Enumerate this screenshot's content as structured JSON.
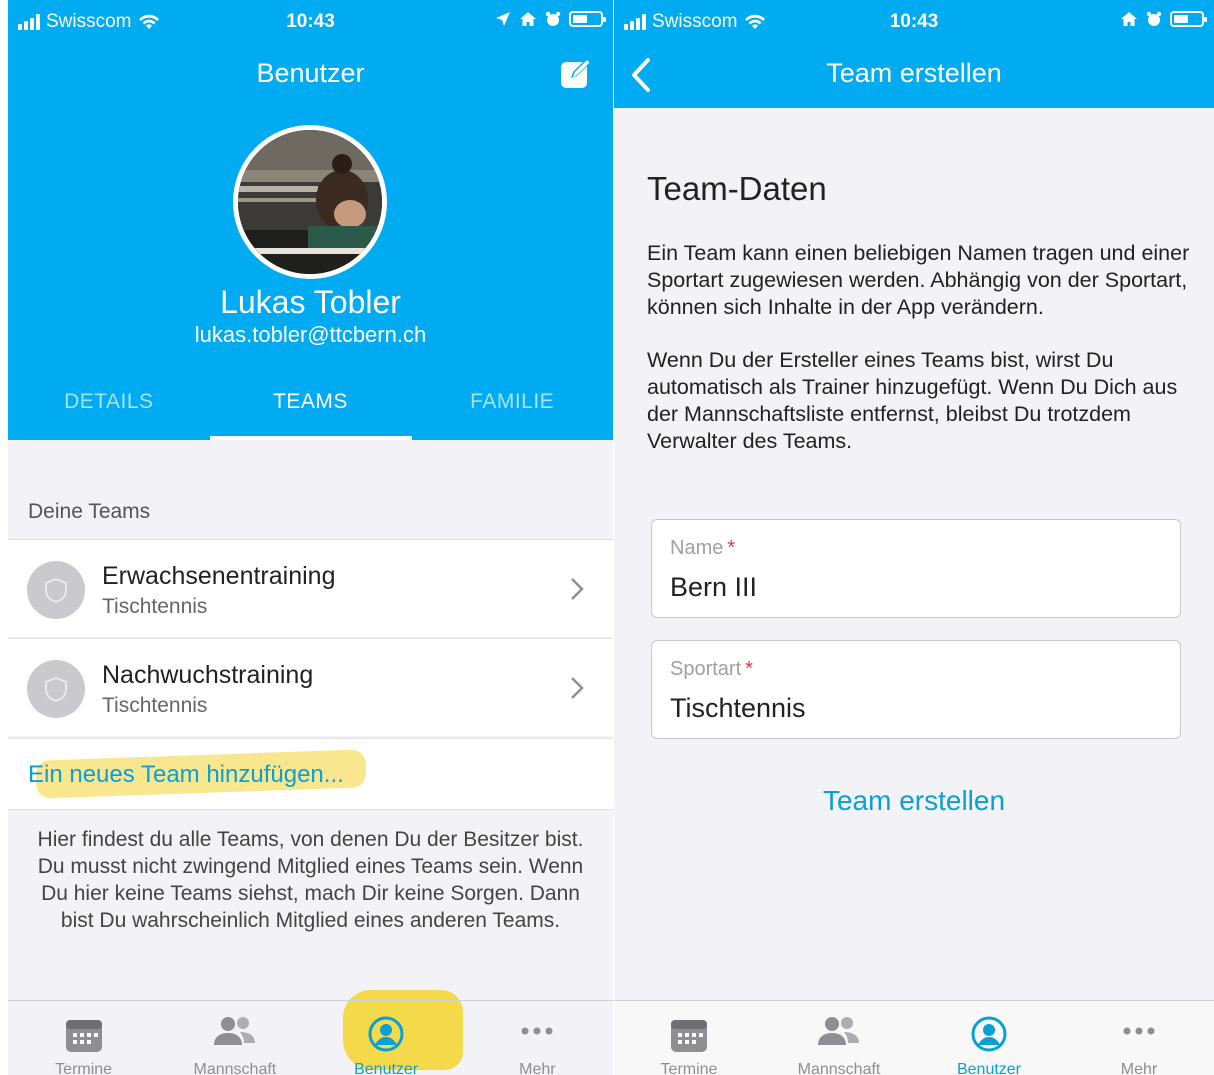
{
  "status_bar": {
    "carrier": "Swisscom",
    "time": "10:43"
  },
  "left_screen": {
    "nav_title": "Benutzer",
    "profile": {
      "name": "Lukas Tobler",
      "email": "lukas.tobler@ttcbern.ch"
    },
    "tabs": [
      {
        "label": "DETAILS",
        "active": false
      },
      {
        "label": "TEAMS",
        "active": true
      },
      {
        "label": "FAMILIE",
        "active": false
      }
    ],
    "section_header": "Deine Teams",
    "teams": [
      {
        "name": "Erwachsenentraining",
        "sport": "Tischtennis"
      },
      {
        "name": "Nachwuchstraining",
        "sport": "Tischtennis"
      }
    ],
    "add_team_label": "Ein neues Team hinzufügen...",
    "info_text": "Hier findest du alle Teams, von denen Du der Besitzer bist. Du musst nicht zwingend Mitglied eines Teams sein. Wenn Du hier keine Teams siehst, mach Dir keine Sorgen. Dann bist Du wahrscheinlich Mitglied eines anderen Teams."
  },
  "right_screen": {
    "nav_title": "Team erstellen",
    "form_title": "Team-Daten",
    "description_1": "Ein Team kann einen beliebigen Namen tragen und einer Sportart zugewiesen werden. Abhängig von der Sportart, können sich Inhalte in der App verändern.",
    "description_2": "Wenn Du der Ersteller eines Teams bist, wirst Du automatisch als Trainer hinzugefügt. Wenn Du Dich aus der Mannschaftsliste entfernst, bleibst Du trotzdem Verwalter des Teams.",
    "fields": [
      {
        "label": "Name",
        "required_mark": "*",
        "value": "Bern III"
      },
      {
        "label": "Sportart",
        "required_mark": "*",
        "value": "Tischtennis"
      }
    ],
    "create_button": "Team erstellen"
  },
  "tab_bar": {
    "items": [
      {
        "label": "Termine",
        "icon": "calendar-icon"
      },
      {
        "label": "Mannschaft",
        "icon": "people-icon"
      },
      {
        "label": "Benutzer",
        "icon": "user-circle-icon",
        "active": true
      },
      {
        "label": "Mehr",
        "icon": "more-dots-icon"
      }
    ]
  },
  "colors": {
    "brand_blue": "#00abf2",
    "link_blue": "#0a9fd6",
    "highlighter_yellow": "#f4d636",
    "required_red": "#e23b3b"
  }
}
